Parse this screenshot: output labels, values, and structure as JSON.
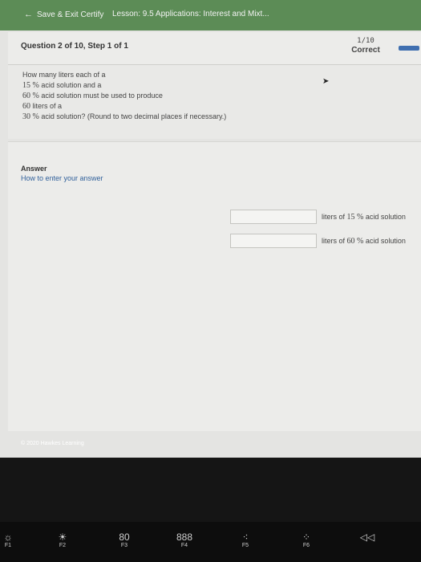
{
  "topbar": {
    "back_label": "Save & Exit Certify",
    "lesson": "Lesson: 9.5 Applications: Interest and Mixt..."
  },
  "question_header": {
    "title": "Question 2 of 10, Step 1 of 1",
    "score": "1/10",
    "status": "Correct"
  },
  "question": {
    "line1": "How many liters each of a",
    "pct1": "15 %",
    "line2_rest": " acid solution and a",
    "pct2": "60 %",
    "line3_rest": " acid solution must be used to produce",
    "total": "60",
    "line4_rest": " liters of a",
    "pct3": "30 %",
    "line5_rest": " acid solution? (Round to two decimal places if necessary.)"
  },
  "answer": {
    "title": "Answer",
    "help_link": "How to enter your answer",
    "rows": [
      {
        "prefix": "liters of ",
        "pct": "15 %",
        "suffix": " acid solution",
        "value": ""
      },
      {
        "prefix": "liters of ",
        "pct": "60 %",
        "suffix": " acid solution",
        "value": ""
      }
    ]
  },
  "footer": "© 2020 Hawkes Learning",
  "keyboard": {
    "f1": "F1",
    "f2": "F2",
    "f3": "F3",
    "f4": "F4",
    "f5": "F5",
    "f3_glyph": "80",
    "f4_glyph": "888",
    "f6_partial": "F6"
  },
  "icons": {
    "brightness": "brightness-icon",
    "mission_control": "mission-control-icon",
    "launchpad": "launchpad-icon",
    "rewind": "rewind-icon"
  }
}
